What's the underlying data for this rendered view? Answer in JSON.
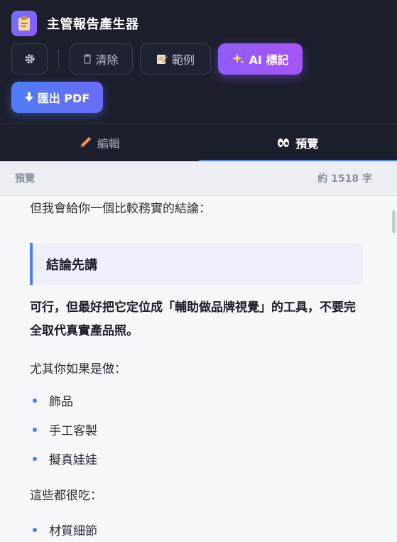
{
  "header": {
    "title": "主管報告產生器",
    "icon": "clipboard-icon"
  },
  "toolbar": {
    "clear_label": "清除",
    "example_label": "範例",
    "ai_label": "AI 標記",
    "export_label": "匯出 PDF"
  },
  "tabs": [
    {
      "label": "編輯",
      "icon": "pencil-icon",
      "active": false
    },
    {
      "label": "預覽",
      "icon": "eyes-icon",
      "active": true
    }
  ],
  "preview_bar": {
    "label": "預覽",
    "count": "約 1518 字"
  },
  "content": {
    "intro": "但我會給你一個比較務實的結論：",
    "callout_title": "結論先講",
    "bold_statement": "可行，但最好把它定位成「輔助做品牌視覺」的工具，不要完全取代真實產品照。",
    "para_especially": "尤其你如果是做：",
    "list_a": [
      "飾品",
      "手工客製",
      "擬真娃娃"
    ],
    "para_demanding": "這些都很吃：",
    "list_b": [
      "材質細節"
    ]
  },
  "colors": {
    "header_bg": "#1b1e2b",
    "accent_blue": "#4f7cf7",
    "accent_purple": "#a855f7"
  }
}
